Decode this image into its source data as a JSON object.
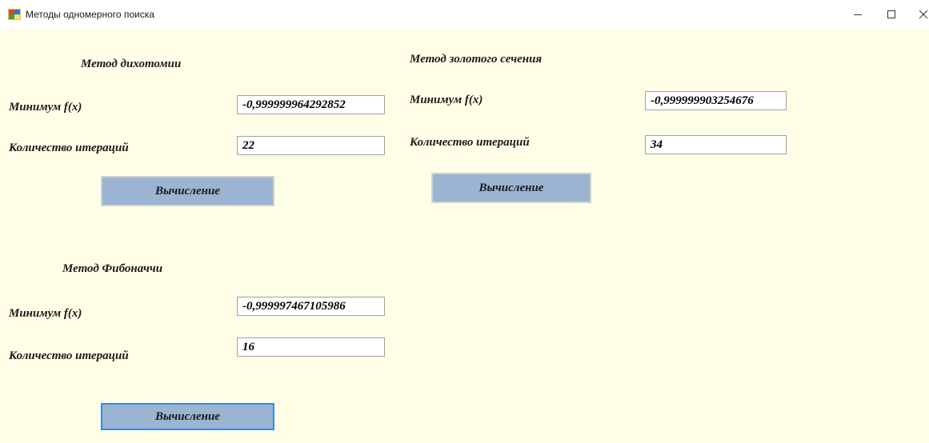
{
  "window": {
    "title": "Методы одномерного поиска",
    "icon": "app-window-icon",
    "controls": [
      "minimize-icon",
      "maximize-icon",
      "close-icon"
    ]
  },
  "colors": {
    "client_background": "#ffffe8",
    "button_background": "#9ab4d2",
    "button_focus_border": "#3a8ad8"
  },
  "dichotomy": {
    "title": "Метод дихотомии",
    "min_label": "Минимум f(x)",
    "min_value": "-0,999999964292852",
    "iter_label": "Количество итераций",
    "iter_value": "22",
    "button": "Вычисление"
  },
  "golden": {
    "title": "Метод золотого сечения",
    "min_label": "Минимум f(x)",
    "min_value": "-0,999999903254676",
    "iter_label": "Количество итераций",
    "iter_value": "34",
    "button": "Вычисление"
  },
  "fibonacci": {
    "title": "Метод Фибоначчи",
    "min_label": "Минимум f(x)",
    "min_value": "-0,999997467105986",
    "iter_label": "Количество итераций",
    "iter_value": "16",
    "button": "Вычисление"
  }
}
